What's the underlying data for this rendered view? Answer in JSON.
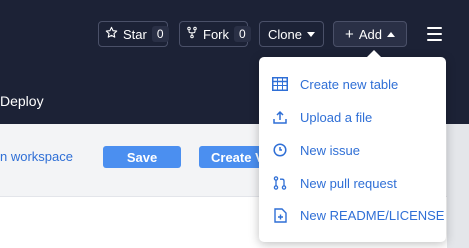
{
  "header": {
    "star_label": "Star",
    "star_count": "0",
    "fork_label": "Fork",
    "fork_count": "0",
    "clone_label": "Clone",
    "add_label": "Add",
    "nav_partial": "Deploy"
  },
  "content": {
    "workspace_text": "n workspace",
    "save_label": "Save",
    "create_label": "Create V"
  },
  "dropdown": {
    "items": [
      {
        "label": "Create new table",
        "icon": "table-icon"
      },
      {
        "label": "Upload a file",
        "icon": "upload-icon"
      },
      {
        "label": "New issue",
        "icon": "issue-icon"
      },
      {
        "label": "New pull request",
        "icon": "pull-request-icon"
      },
      {
        "label": "New README/LICENSE",
        "icon": "file-plus-icon"
      }
    ]
  },
  "colors": {
    "header_bg": "#1c2236",
    "accent_blue": "#2f6fd6",
    "button_blue": "#4b8ff0"
  }
}
